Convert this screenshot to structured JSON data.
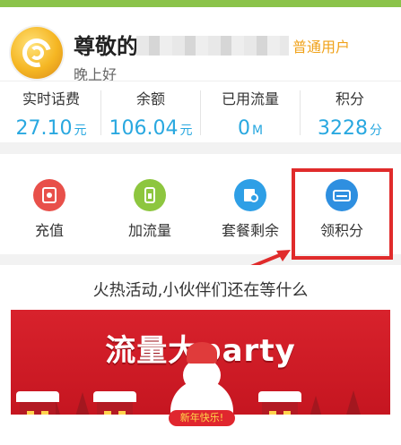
{
  "header": {
    "title_prefix": "尊敬的",
    "user_type": "普通用户",
    "greeting": "晚上好"
  },
  "stats": [
    {
      "label": "实时话费",
      "value": "27.10",
      "unit": "元"
    },
    {
      "label": "余额",
      "value": "106.04",
      "unit": "元"
    },
    {
      "label": "已用流量",
      "value": "0",
      "unit": "M"
    },
    {
      "label": "积分",
      "value": "3228",
      "unit": "分"
    }
  ],
  "actions": [
    {
      "label": "充值",
      "icon": "recharge-icon",
      "color": "#e8504a"
    },
    {
      "label": "加流量",
      "icon": "add-traffic-icon",
      "color": "#8dc63f"
    },
    {
      "label": "套餐剩余",
      "icon": "package-remaining-icon",
      "color": "#2e9fe6"
    },
    {
      "label": "领积分",
      "icon": "points-card-icon",
      "color": "#2e8fe0"
    }
  ],
  "activity": {
    "title": "火热活动,小伙伴们还在等什么",
    "banner_title": "流量大party",
    "banner_ribbon": "新年快乐!"
  },
  "colors": {
    "accent": "#29a8e0",
    "highlight_box": "#e02b2b",
    "top_bar": "#8bc34a",
    "user_type": "#f0a21a"
  }
}
